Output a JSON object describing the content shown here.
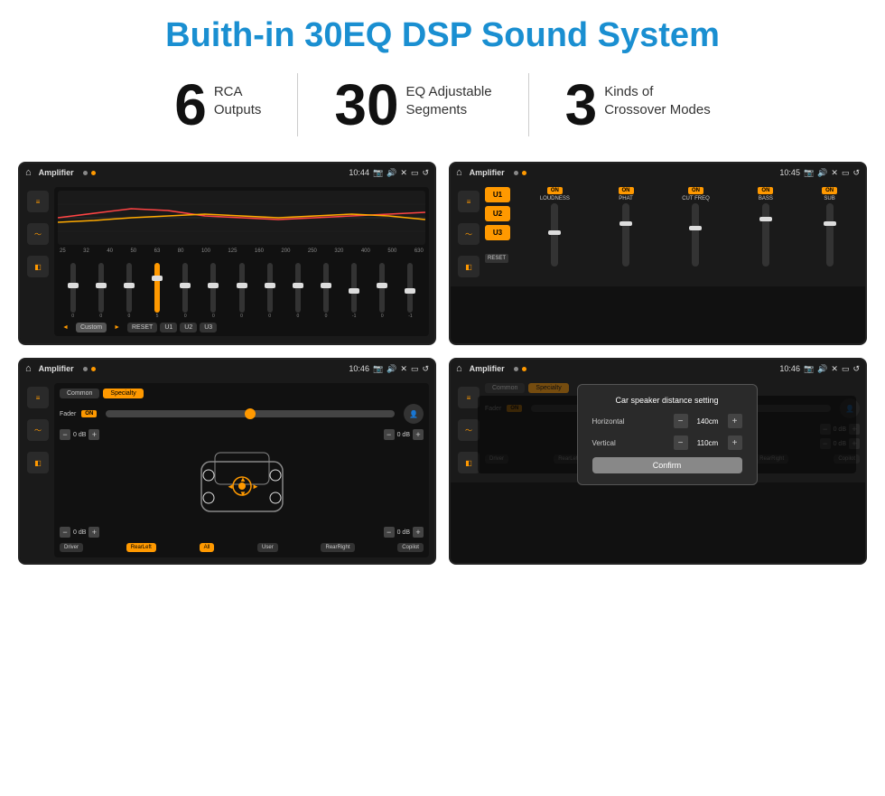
{
  "header": {
    "title": "Buith-in 30EQ DSP Sound System"
  },
  "stats": [
    {
      "number": "6",
      "text_line1": "RCA",
      "text_line2": "Outputs"
    },
    {
      "number": "30",
      "text_line1": "EQ Adjustable",
      "text_line2": "Segments"
    },
    {
      "number": "3",
      "text_line1": "Kinds of",
      "text_line2": "Crossover Modes"
    }
  ],
  "screens": {
    "screen1": {
      "status_bar": {
        "title": "Amplifier",
        "time": "10:44"
      },
      "eq_labels": [
        "25",
        "32",
        "40",
        "50",
        "63",
        "80",
        "100",
        "125",
        "160",
        "200",
        "250",
        "320",
        "400",
        "500",
        "630"
      ],
      "eq_values": [
        "0",
        "0",
        "0",
        "5",
        "0",
        "0",
        "0",
        "0",
        "0",
        "0",
        "-1",
        "0",
        "-1"
      ],
      "bottom_buttons": [
        "◄",
        "Custom",
        "►",
        "RESET",
        "U1",
        "U2",
        "U3"
      ]
    },
    "screen2": {
      "status_bar": {
        "title": "Amplifier",
        "time": "10:45"
      },
      "presets": [
        "U1",
        "U2",
        "U3"
      ],
      "controls": [
        "LOUDNESS",
        "PHAT",
        "CUT FREQ",
        "BASS",
        "SUB"
      ],
      "reset_label": "RESET"
    },
    "screen3": {
      "status_bar": {
        "title": "Amplifier",
        "time": "10:46"
      },
      "tabs": [
        "Common",
        "Specialty"
      ],
      "fader_label": "Fader",
      "fader_on": "ON",
      "db_values": [
        "0 dB",
        "0 dB",
        "0 dB",
        "0 dB"
      ],
      "buttons": [
        "Driver",
        "RearLeft",
        "All",
        "User",
        "RearRight",
        "Copilot"
      ]
    },
    "screen4": {
      "status_bar": {
        "title": "Amplifier",
        "time": "10:46"
      },
      "tabs": [
        "Common",
        "Specialty"
      ],
      "dialog": {
        "title": "Car speaker distance setting",
        "horizontal_label": "Horizontal",
        "horizontal_value": "140cm",
        "vertical_label": "Vertical",
        "vertical_value": "110cm",
        "confirm_label": "Confirm",
        "db_values": [
          "0 dB",
          "0 dB"
        ]
      },
      "buttons": [
        "Driver",
        "RearLeft",
        "All",
        "User",
        "RearRight",
        "Copilot"
      ]
    }
  }
}
